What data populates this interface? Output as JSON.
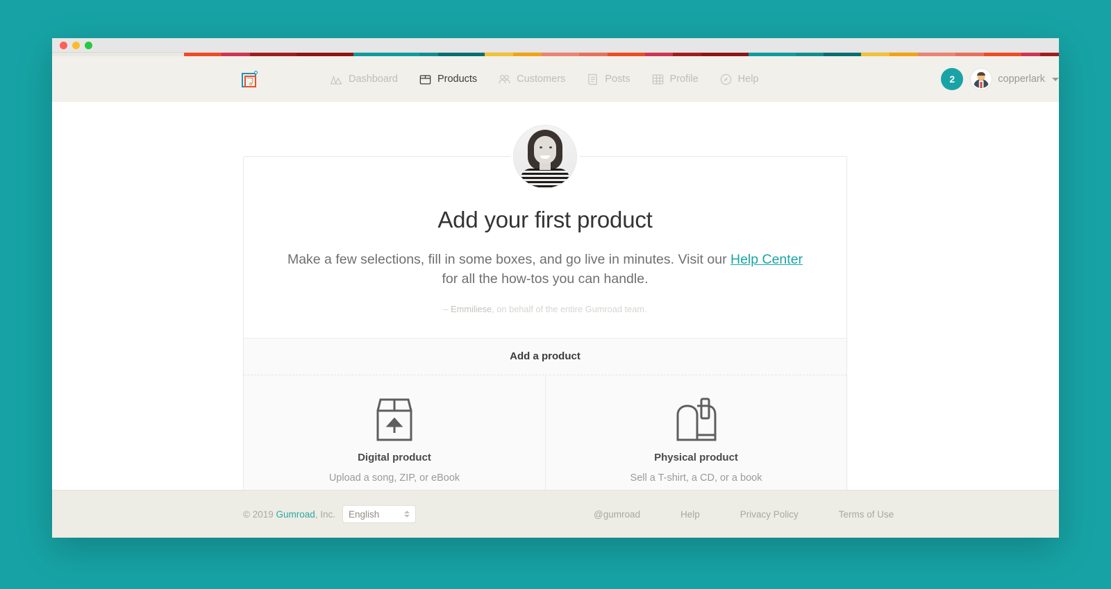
{
  "theme": {
    "page_bg": "#17a3a5",
    "nav_bg": "#f1f0ea",
    "footer_bg": "#edece5",
    "accent_teal": "#19a3a5",
    "link_teal": "#2ba89d",
    "muted_text": "#a9a8a0"
  },
  "window": {
    "traffic_lights": [
      "close",
      "minimize",
      "maximize"
    ],
    "stripe_colors": [
      "#e9e8e1",
      "#f04a23",
      "#cf3452",
      "#a01d1d",
      "#8e1414",
      "#0f9c9e",
      "#0f8e90",
      "#046f72",
      "#f2c230",
      "#f2a40e",
      "#ee8273",
      "#e96f5c",
      "#f04a23",
      "#cf3452",
      "#a01d1d",
      "#8e1414",
      "#0f9c9e",
      "#0f8e90",
      "#046f72",
      "#f2c230",
      "#f2a40e",
      "#ee8273",
      "#e96f5c",
      "#f04a23",
      "#cf3452",
      "#a01d1d"
    ]
  },
  "nav": {
    "logo_name": "gumroad-logo",
    "items": [
      {
        "label": "Dashboard",
        "icon": "chart-mountain-icon",
        "active": false
      },
      {
        "label": "Products",
        "icon": "box-icon",
        "active": true
      },
      {
        "label": "Customers",
        "icon": "people-icon",
        "active": false
      },
      {
        "label": "Posts",
        "icon": "document-icon",
        "active": false
      },
      {
        "label": "Profile",
        "icon": "grid-icon",
        "active": false
      },
      {
        "label": "Help",
        "icon": "compass-icon",
        "active": false
      }
    ],
    "notification_count": "2",
    "username": "copperlark"
  },
  "main": {
    "avatar_name": "emmiliese-avatar-photo",
    "title": "Add your first product",
    "subtitle_before": "Make a few selections, fill in some boxes, and go live in minutes. Visit our ",
    "subtitle_link": "Help Center",
    "subtitle_after": " for all the how-tos you can handle.",
    "quote_dash": "– ",
    "quote_name": "Emmiliese",
    "quote_rest": ", on behalf of the entire Gumroad team.",
    "add_product_header": "Add a product",
    "options": [
      {
        "icon": "box-upload-icon",
        "title": "Digital product",
        "desc": "Upload a song, ZIP, or eBook"
      },
      {
        "icon": "mailbox-icon",
        "title": "Physical product",
        "desc": "Sell a T-shirt, a CD, or a book"
      }
    ]
  },
  "footer": {
    "copyright_prefix": "© 2019 ",
    "copyright_link": "Gumroad",
    "copyright_suffix": ", Inc.",
    "language_value": "English",
    "links": [
      "@gumroad",
      "Help",
      "Privacy Policy",
      "Terms of Use"
    ]
  }
}
